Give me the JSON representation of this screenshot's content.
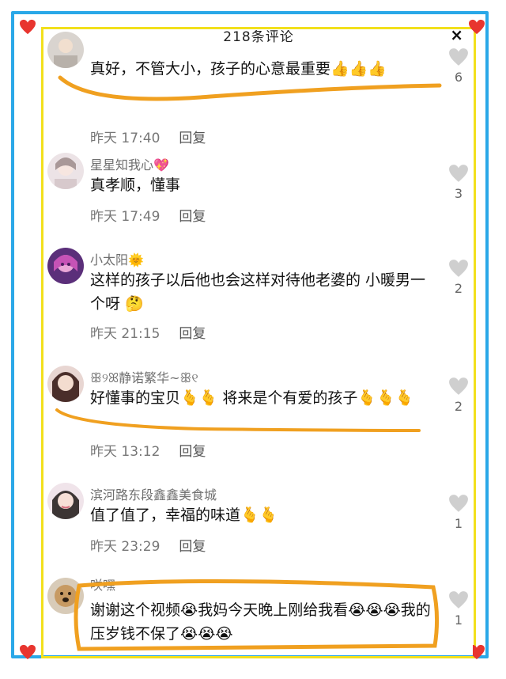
{
  "header": {
    "title": "218条评论",
    "close": "×"
  },
  "comments": [
    {
      "name": "",
      "text": "真好，不管大小，孩子的心意最重要👍👍👍",
      "time": "昨天 17:40",
      "reply": "回复",
      "likes": "6"
    },
    {
      "name": "星星知我心💖",
      "text": "真孝顺，懂事",
      "time": "昨天 17:49",
      "reply": "回复",
      "likes": "3"
    },
    {
      "name": "小太阳🌞",
      "text": "这样的孩子以后他也会这样对待他老婆的 小暖男一个呀 🤔",
      "time": "昨天 21:15",
      "reply": "回复",
      "likes": "2"
    },
    {
      "name": "ꕥ୨ꕤ静诺繁华~ꕥ୧",
      "text": "好懂事的宝贝🫰🫰 将来是个有爱的孩子🫰🫰🫰",
      "time": "昨天 13:12",
      "reply": "回复",
      "likes": "2"
    },
    {
      "name": "滨河路东段鑫鑫美食城",
      "text": "值了值了，幸福的味道🫰🫰",
      "time": "昨天 23:29",
      "reply": "回复",
      "likes": "1"
    },
    {
      "name": "咲嘿",
      "text": "谢谢这个视频😭我妈今天晚上刚给我看😭😭😭我的压岁钱不保了😭😭😭",
      "time": "",
      "reply": "",
      "likes": "1"
    }
  ],
  "colors": {
    "frame_blue": "#2aa8e8",
    "frame_yellow": "#f2e01c",
    "heart_red": "#e8352f",
    "scribble": "#f0a020"
  }
}
